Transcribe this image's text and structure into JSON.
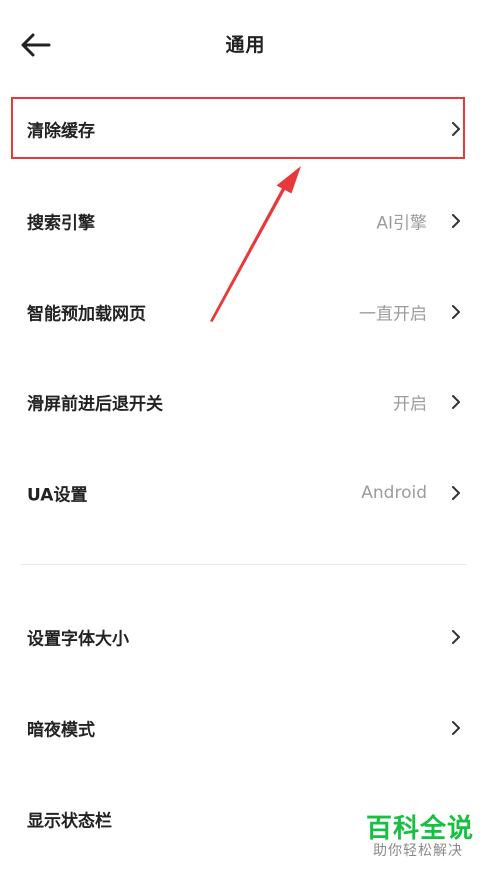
{
  "header": {
    "title": "通用",
    "back_icon": "arrow-left-icon"
  },
  "settings": {
    "items": [
      {
        "label": "清除缓存",
        "value": ""
      },
      {
        "label": "搜索引擎",
        "value": "AI引擎"
      },
      {
        "label": "智能预加载网页",
        "value": "一直开启"
      },
      {
        "label": "滑屏前进后退开关",
        "value": "开启"
      },
      {
        "label": "UA设置",
        "value": "Android"
      },
      {
        "label": "设置字体大小",
        "value": ""
      },
      {
        "label": "暗夜模式",
        "value": ""
      },
      {
        "label": "显示状态栏",
        "value": ""
      }
    ]
  },
  "annotation": {
    "color": "#e8383c"
  },
  "watermark": {
    "title": "百科全说",
    "subtitle": "助你轻松解决",
    "color": "#18c041"
  }
}
